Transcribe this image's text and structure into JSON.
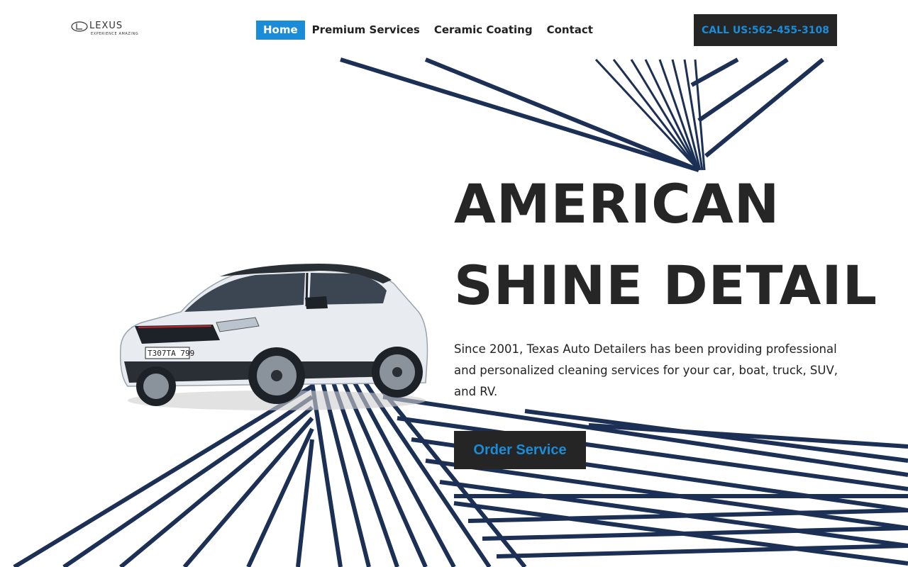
{
  "brand": {
    "logo_word": "LEXUS",
    "logo_tagline": "EXPERIENCE AMAZING"
  },
  "nav": {
    "items": [
      {
        "label": "Home",
        "active": true
      },
      {
        "label": "Premium Services",
        "active": false
      },
      {
        "label": "Ceramic Coating",
        "active": false
      },
      {
        "label": "Contact",
        "active": false
      }
    ]
  },
  "header": {
    "call_label": "CALL US:562-455-3108"
  },
  "hero": {
    "title_line1": "AMERICAN",
    "title_line2": "SHINE DETAIL",
    "description": "Since 2001, Texas Auto Detailers has been providing professional and personalized cleaning services for your car, boat, truck, SUV, and RV.",
    "cta_label": "Order Service",
    "car_plate": "T307TA 799"
  },
  "colors": {
    "accent": "#1a8cd8",
    "dark": "#252525",
    "lines": "#1c2f55"
  },
  "icons": {
    "logo": "lexus-logo-icon"
  }
}
